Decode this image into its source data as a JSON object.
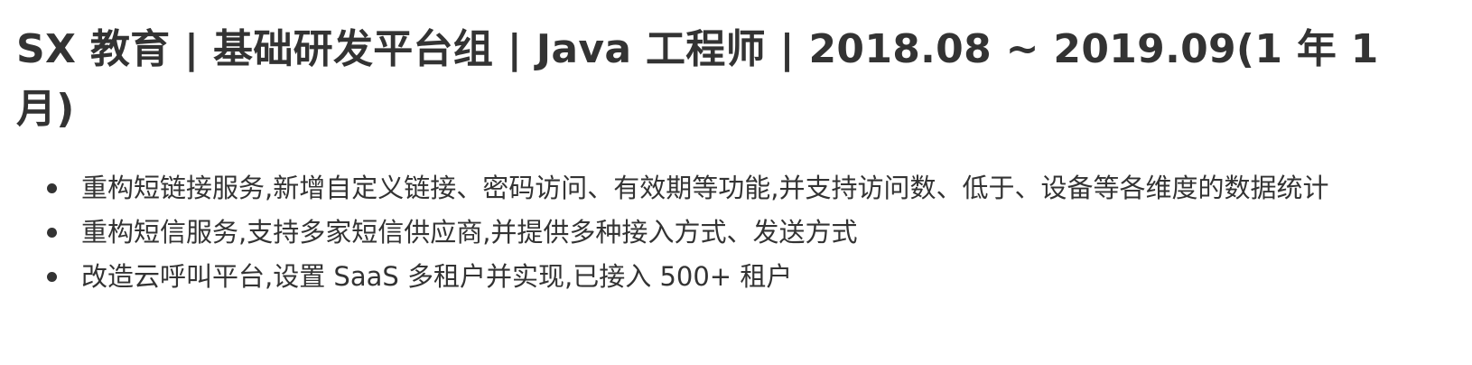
{
  "experience": {
    "heading": "SX 教育 | 基础研发平台组 | Java 工程师 | 2018.08 ~ 2019.09(1 年 1 月)",
    "bullets": [
      "重构短链接服务,新增自定义链接、密码访问、有效期等功能,并支持访问数、低于、设备等各维度的数据统计",
      "重构短信服务,支持多家短信供应商,并提供多种接入方式、发送方式",
      "改造云呼叫平台,设置 SaaS 多租户并实现,已接入 500+ 租户"
    ]
  }
}
